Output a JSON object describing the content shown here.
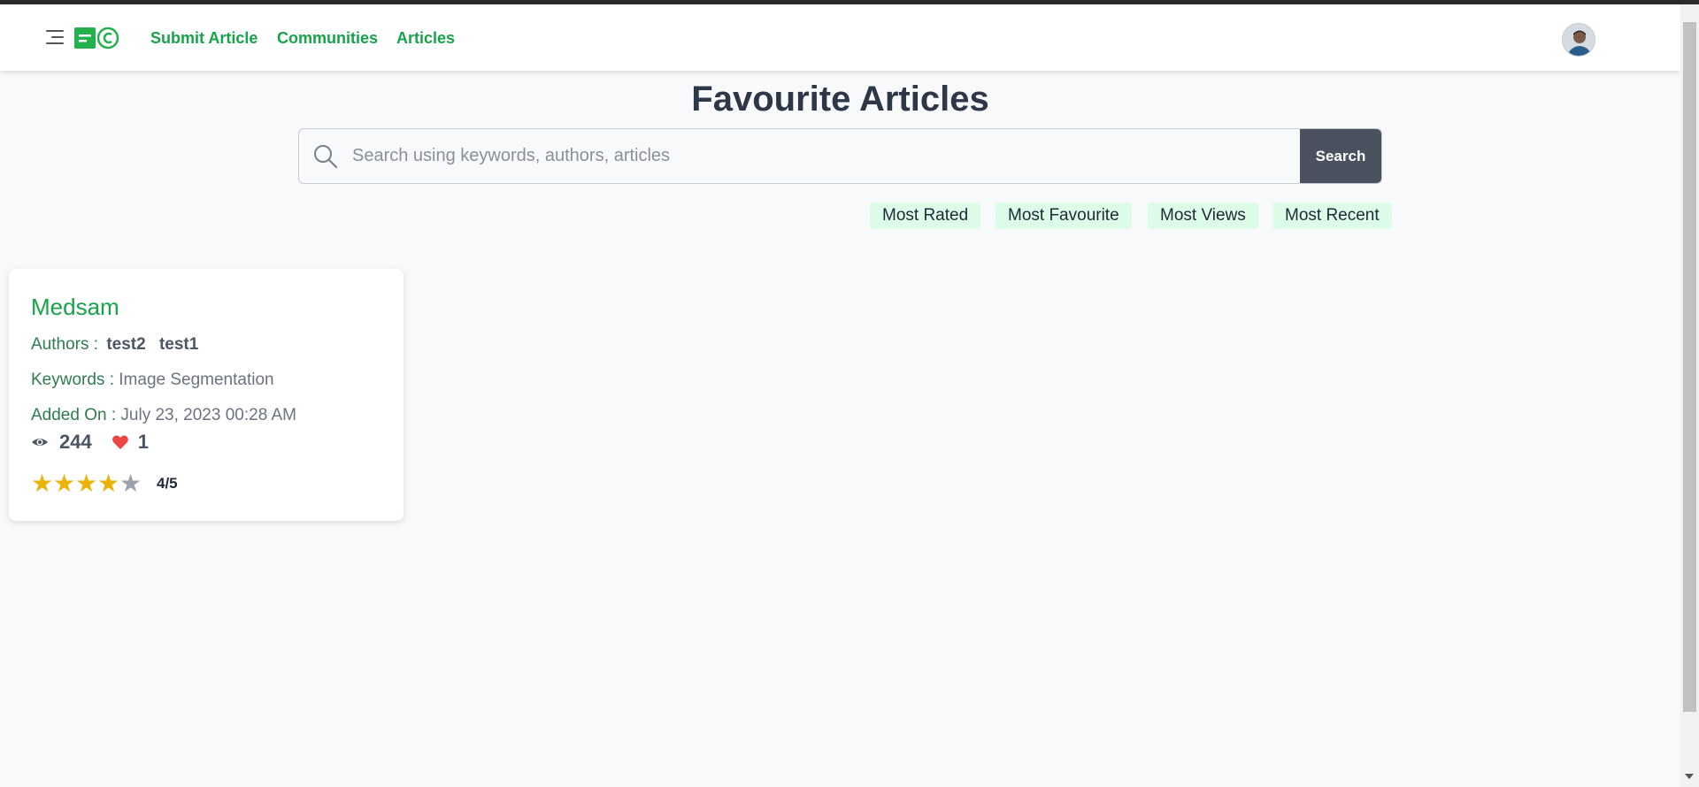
{
  "nav": {
    "links": [
      "Submit Article",
      "Communities",
      "Articles"
    ]
  },
  "page": {
    "title": "Favourite Articles"
  },
  "search": {
    "placeholder": "Search using keywords, authors, articles",
    "button_label": "Search"
  },
  "filters": [
    "Most Rated",
    "Most Favourite",
    "Most Views",
    "Most Recent"
  ],
  "articles": [
    {
      "title": "Medsam",
      "authors_label": "Authors :",
      "authors": [
        "test2",
        "test1"
      ],
      "keywords_label": "Keywords :",
      "keywords": "Image Segmentation",
      "added_label": "Added On :",
      "added_on": "July 23, 2023 00:28 AM",
      "views": "244",
      "favourites": "1",
      "rating": 4,
      "rating_max": 5,
      "rating_text": "4/5"
    }
  ],
  "icons": {
    "menu": "menu-icon",
    "logo": "logo-icon",
    "search": "search-icon",
    "views": "eye-icon",
    "favourites": "heart-icon",
    "star": "star-icon"
  },
  "colors": {
    "accent": "#16a34a",
    "chip_bg": "#dcfce7",
    "button_bg": "#4a5260",
    "star_filled": "#eab308",
    "star_empty": "#9ca3af",
    "heart": "#ef4444"
  }
}
